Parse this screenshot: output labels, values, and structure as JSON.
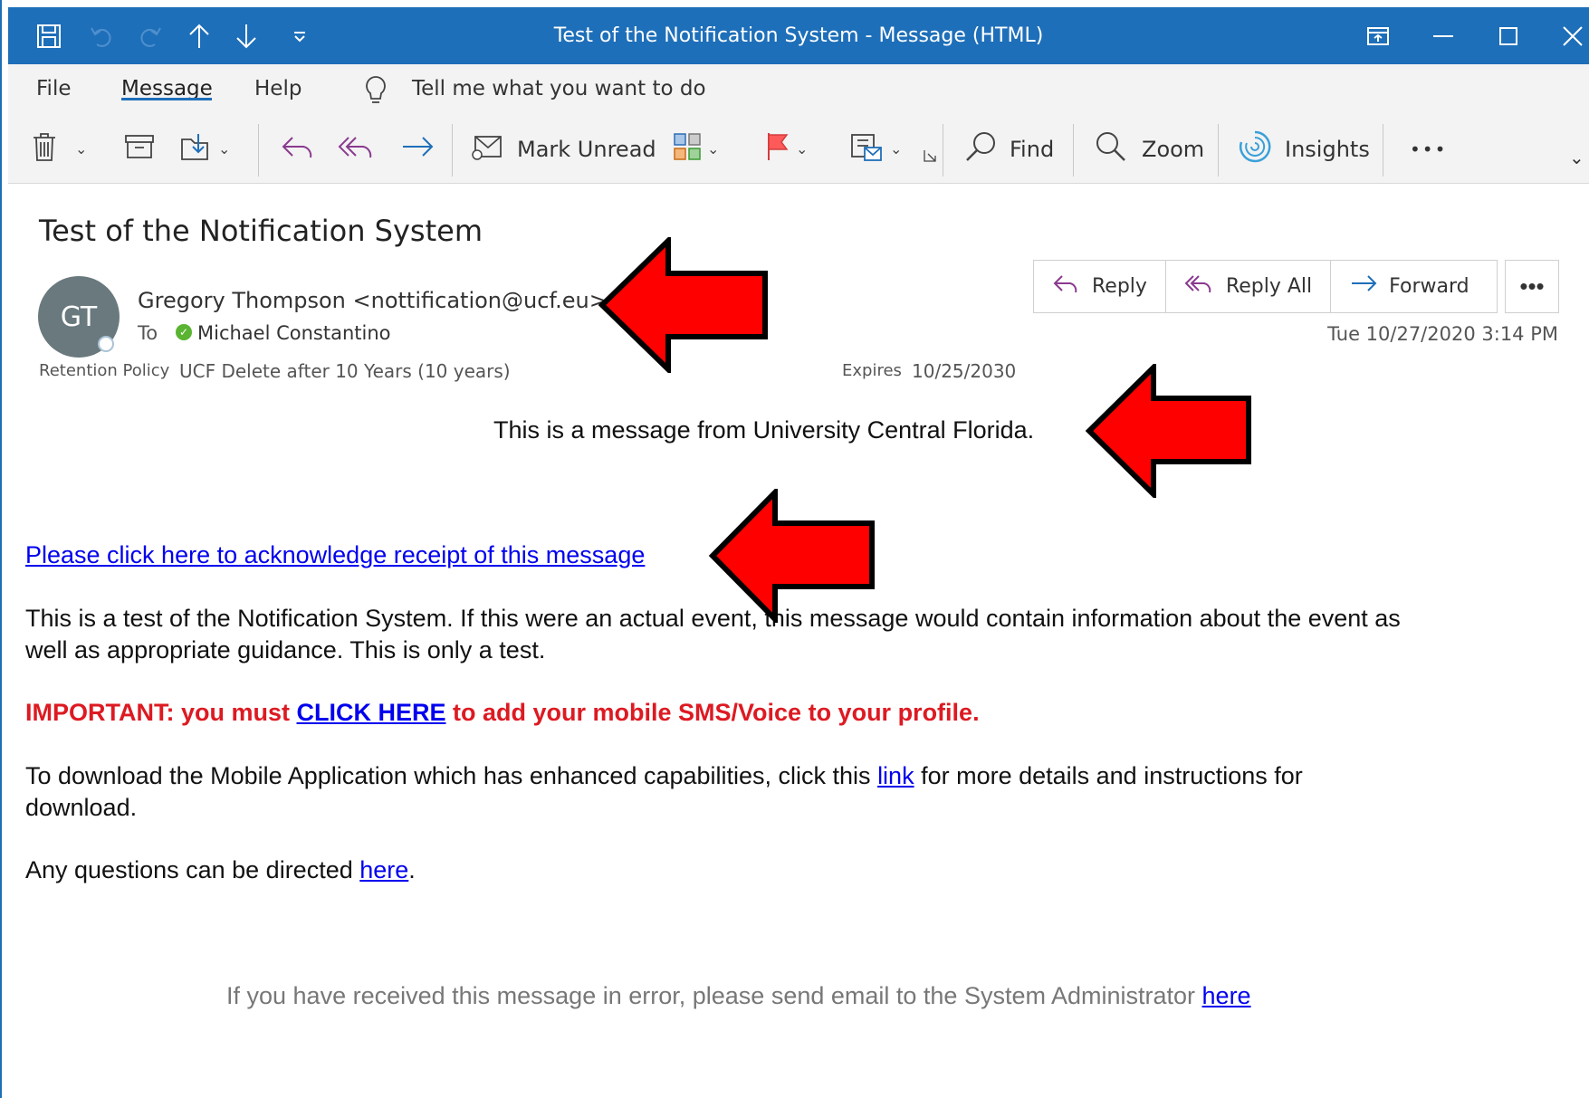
{
  "window": {
    "title": "Test of the Notification System  -  Message (HTML)"
  },
  "menu": {
    "file": "File",
    "message": "Message",
    "help": "Help",
    "tell_me": "Tell me what you want to do"
  },
  "ribbon": {
    "mark_unread": "Mark Unread",
    "find": "Find",
    "zoom": "Zoom",
    "insights": "Insights",
    "more": "•••"
  },
  "message": {
    "subject": "Test of the Notification System",
    "avatar_initials": "GT",
    "sender": "Gregory Thompson <nottification@ucf.eu>",
    "to_label": "To",
    "to_name": "Michael Constantino",
    "retention_label": "Retention Policy",
    "retention_value": "UCF Delete after 10 Years (10 years)",
    "expires_label": "Expires",
    "expires_value": "10/25/2030",
    "timestamp": "Tue 10/27/2020 3:14 PM"
  },
  "actions": {
    "reply": "Reply",
    "reply_all": "Reply All",
    "forward": "Forward",
    "more": "•••"
  },
  "body": {
    "intro": "This is a message from University Central Florida.",
    "ack_link": "Please click here to acknowledge receipt of this message",
    "para1_line1": "This is a test of the Notification System. If this were an actual event, this message would contain information about the event as",
    "para1_line2": "well as appropriate guidance. This is only a test.",
    "important_prefix": "IMPORTANT: you must ",
    "important_link": "CLICK HERE",
    "important_suffix": " to add your mobile SMS/Voice to your profile.",
    "download_prefix": "To download the Mobile Application which has enhanced capabilities, click this ",
    "download_link": "link",
    "download_suffix": " for more details and instructions for",
    "download_line2": "download.",
    "questions_prefix": "Any questions can be directed ",
    "questions_link": "here",
    "questions_suffix": ".",
    "footer_prefix": "If you have received this message in error, please send email to the System Administrator ",
    "footer_link": "here"
  },
  "colors": {
    "titlebar": "#1e6fb9",
    "link": "#0000ee",
    "important": "#dd1a22",
    "arrow_fill": "#ff0000"
  }
}
